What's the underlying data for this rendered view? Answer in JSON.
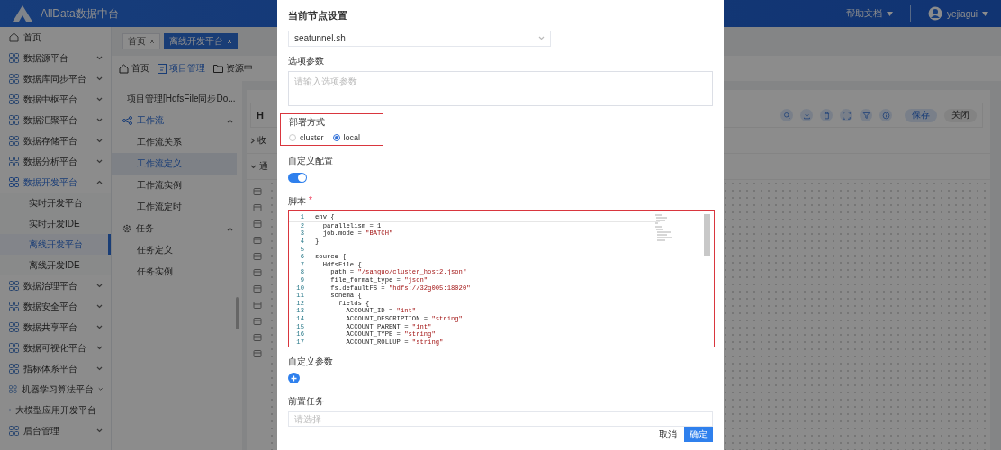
{
  "header": {
    "title": "AllData数据中台",
    "help": "帮助文档",
    "user": "yejiagui"
  },
  "sidebar": {
    "items": [
      {
        "label": "首页",
        "kind": "link",
        "selected": false
      },
      {
        "label": "数据源平台",
        "kind": "group",
        "expanded": false
      },
      {
        "label": "数据库同步平台",
        "kind": "group",
        "expanded": false
      },
      {
        "label": "数据中枢平台",
        "kind": "group",
        "expanded": false
      },
      {
        "label": "数据汇聚平台",
        "kind": "group",
        "expanded": false
      },
      {
        "label": "数据存储平台",
        "kind": "group",
        "expanded": false
      },
      {
        "label": "数据分析平台",
        "kind": "group",
        "expanded": false
      },
      {
        "label": "数据开发平台",
        "kind": "group",
        "expanded": true,
        "children": [
          {
            "label": "实时开发平台",
            "selected": false
          },
          {
            "label": "实时开发IDE",
            "selected": false
          },
          {
            "label": "离线开发平台",
            "selected": true
          },
          {
            "label": "离线开发IDE",
            "selected": false
          }
        ]
      },
      {
        "label": "数据治理平台",
        "kind": "group",
        "expanded": false
      },
      {
        "label": "数据安全平台",
        "kind": "group",
        "expanded": false
      },
      {
        "label": "数据共享平台",
        "kind": "group",
        "expanded": false
      },
      {
        "label": "数据可视化平台",
        "kind": "group",
        "expanded": false
      },
      {
        "label": "指标体系平台",
        "kind": "group",
        "expanded": false
      },
      {
        "label": "机器学习算法平台",
        "kind": "group",
        "expanded": false
      },
      {
        "label": "大模型应用开发平台",
        "kind": "group",
        "expanded": false
      },
      {
        "label": "后台管理",
        "kind": "group",
        "expanded": false
      }
    ]
  },
  "tabs": [
    {
      "label": "首页",
      "selected": false
    },
    {
      "label": "离线开发平台",
      "selected": true
    }
  ],
  "breadcrumb": [
    {
      "label": "首页",
      "selected": false
    },
    {
      "label": "项目管理",
      "selected": true
    },
    {
      "label": "资源中",
      "selected": false
    }
  ],
  "project_menu": {
    "project": "项目管理[HdfsFile同步Do...",
    "groups": [
      {
        "label": "工作流",
        "expanded": true,
        "selected": true,
        "children": [
          {
            "label": "工作流关系",
            "selected": false
          },
          {
            "label": "工作流定义",
            "selected": true
          },
          {
            "label": "工作流实例",
            "selected": false
          },
          {
            "label": "工作流定时",
            "selected": false
          }
        ]
      },
      {
        "label": "任务",
        "expanded": true,
        "selected": false,
        "children": [
          {
            "label": "任务定义",
            "selected": false
          },
          {
            "label": "任务实例",
            "selected": false
          }
        ]
      }
    ]
  },
  "canvas": {
    "title": "H",
    "sections": [
      {
        "label": "收",
        "expanded": false
      },
      {
        "label": "通",
        "expanded": true
      }
    ],
    "buttons": [
      {
        "label": "保存",
        "kind": "primary"
      },
      {
        "label": "关闭",
        "kind": "default"
      }
    ]
  },
  "dialog": {
    "title": "当前节点设置",
    "script_select": {
      "value": "seatunnel.sh"
    },
    "options": {
      "label": "选项参数",
      "placeholder": "请输入选项参数"
    },
    "deploy": {
      "label": "部署方式",
      "highlighted": true,
      "options": [
        {
          "label": "cluster",
          "selected": false
        },
        {
          "label": "local",
          "selected": true
        }
      ]
    },
    "custom_config": {
      "label": "自定义配置",
      "on": true
    },
    "script": {
      "label": "脚本",
      "required_mark": "*",
      "highlighted": true,
      "lines": [
        {
          "number": "1",
          "code": "env {"
        },
        {
          "number": "2",
          "code": "  parallelism = 1"
        },
        {
          "number": "3",
          "code": "  job.mode = \"BATCH\""
        },
        {
          "number": "4",
          "code": "}"
        },
        {
          "number": "5"
        },
        {
          "number": "6",
          "code": "source {"
        },
        {
          "number": "7",
          "code": "  HdfsFile {"
        },
        {
          "number": "8",
          "code": "    path = \"/sanguo/cluster_host2.json\""
        },
        {
          "number": "9",
          "code": "    file_format_type = \"json\""
        },
        {
          "number": "10",
          "code": "    fs.defaultFS = \"hdfs://32g005:18020\""
        },
        {
          "number": "11",
          "code": "    schema {"
        },
        {
          "number": "12",
          "code": "      fields {"
        },
        {
          "number": "13",
          "code": "        ACCOUNT_ID = \"int\""
        },
        {
          "number": "14",
          "code": "        ACCOUNT_DESCRIPTION = \"string\""
        },
        {
          "number": "15",
          "code": "        ACCOUNT_PARENT = \"int\""
        },
        {
          "number": "16",
          "code": "        ACCOUNT_TYPE = \"string\""
        },
        {
          "number": "17",
          "code": "        ACCOUNT_ROLLUP = \"string\""
        }
      ]
    },
    "custom_params": {
      "label": "自定义参数"
    },
    "pre_tasks": {
      "label": "前置任务",
      "placeholder": "请选择"
    },
    "buttons": [
      {
        "label": "取消",
        "kind": "text"
      },
      {
        "label": "确定",
        "kind": "primary"
      }
    ]
  }
}
